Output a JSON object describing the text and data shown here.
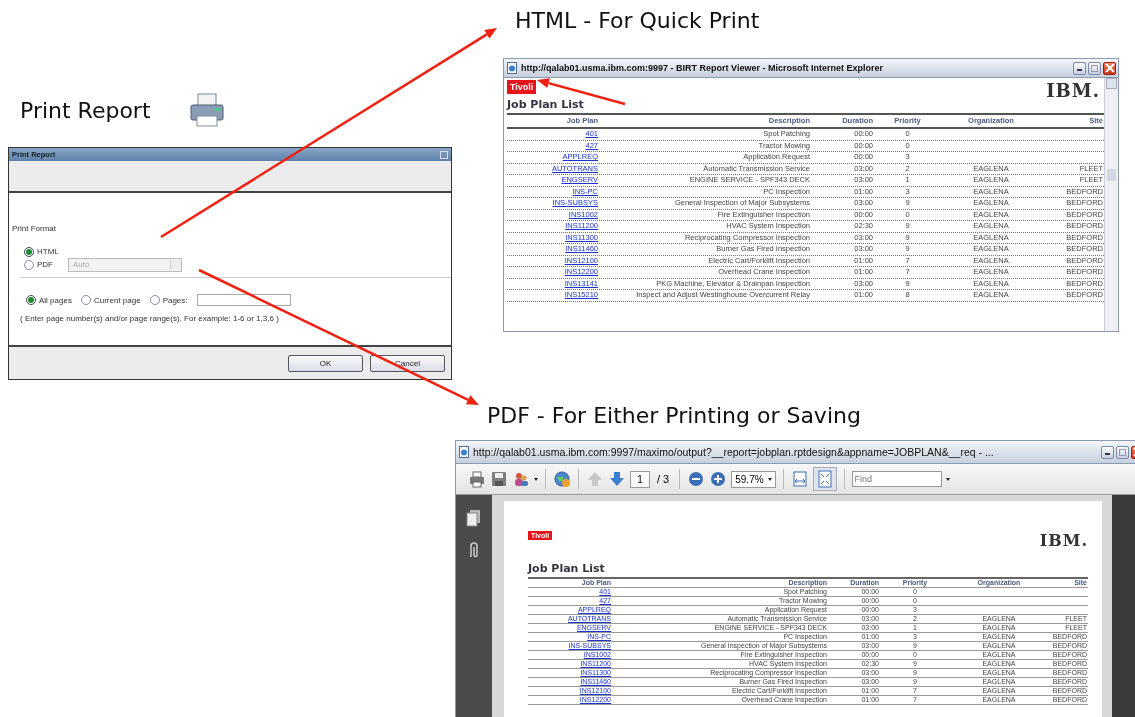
{
  "slide": {
    "print_heading": "Print Report",
    "html_heading": "HTML - For Quick Print",
    "pdf_heading": "PDF - For Either Printing or Saving"
  },
  "print_dialog": {
    "title": "Print Report",
    "format_label": "Print Format",
    "formats": [
      {
        "label": "HTML",
        "selected": true
      },
      {
        "label": "PDF",
        "selected": false
      }
    ],
    "pdf_option": {
      "value": "Auto",
      "disabled": true
    },
    "page_ranges": [
      {
        "label": "All pages",
        "selected": true
      },
      {
        "label": "Current page",
        "selected": false
      },
      {
        "label": "Pages:",
        "selected": false
      }
    ],
    "hint": "( Enter page number(s) and/or page range(s). For example: 1-6 or 1,3,6 )",
    "buttons": [
      "OK",
      "Cancel"
    ]
  },
  "html_window": {
    "title": "http://qalab01.usma.ibm.com:9997 - BIRT Report Viewer - Microsoft Internet Explorer",
    "brand": "Tivoli",
    "logo": "IBM.",
    "report_title": "Job Plan List",
    "columns": [
      "Job Plan",
      "Description",
      "Duration",
      "Priority",
      "Organization",
      "Site"
    ],
    "rows": [
      [
        "401",
        "Spot Patching",
        "00:00",
        "0",
        null,
        null
      ],
      [
        "427",
        "Tractor Mowing",
        "00:00",
        "0",
        null,
        null
      ],
      [
        "APPLREQ",
        "Application Request",
        "00:00",
        "3",
        null,
        null
      ],
      [
        "AUTOTRANS",
        "Automatic Transmission Service",
        "03:00",
        "2",
        "EAGLENA",
        "FLEET"
      ],
      [
        "ENGSERV",
        "ENGINE SERVICE - SPF343 DECK",
        "03:00",
        "1",
        "EAGLENA",
        "FLEET"
      ],
      [
        "INS-PC",
        "PC Inspection",
        "01:00",
        "3",
        "EAGLENA",
        "BEDFORD"
      ],
      [
        "INS-SUBSYS",
        "General Inspection of Major Subsystems",
        "03:00",
        "9",
        "EAGLENA",
        "BEDFORD"
      ],
      [
        "INS1002",
        "Fire Extinguisher Inspection",
        "00:00",
        "0",
        "EAGLENA",
        "BEDFORD"
      ],
      [
        "INS11200",
        "HVAC System Inspection",
        "02:30",
        "9",
        "EAGLENA",
        "BEDFORD"
      ],
      [
        "INS11300",
        "Reciprocating Compressor Inspection",
        "03:00",
        "9",
        "EAGLENA",
        "BEDFORD"
      ],
      [
        "INS11460",
        "Burner Gas Fired Inspection",
        "03:00",
        "9",
        "EAGLENA",
        "BEDFORD"
      ],
      [
        "INS12100",
        "Electric Cart/Forklift Inspection",
        "01:00",
        "7",
        "EAGLENA",
        "BEDFORD"
      ],
      [
        "INS12200",
        "Overhead Crane Inspection",
        "01:00",
        "7",
        "EAGLENA",
        "BEDFORD"
      ],
      [
        "INS13141",
        "PKG Machine, Elevator & Drainpan Inspection",
        "03:00",
        "9",
        "EAGLENA",
        "BEDFORD"
      ],
      [
        "INS15210",
        "Inspect and Adjust Westinghouse Overcurrent Relay",
        "01:00",
        "8",
        "EAGLENA",
        "BEDFORD"
      ]
    ]
  },
  "pdf_window": {
    "title": "http://qalab01.usma.ibm.com:9997/maximo/output?__report=jobplan.rptdesign&appname=JOBPLAN&__req - ...",
    "page": "1",
    "page_count": "/ 3",
    "zoom": "59.7%",
    "find": {
      "placeholder": "Find"
    },
    "brand": "Tivoli",
    "logo": "IBM.",
    "report_title": "Job Plan List",
    "columns": [
      "Job Plan",
      "Description",
      "Duration",
      "Priority",
      "Organization",
      "Site"
    ],
    "rows": [
      [
        "401",
        "Spot Patching",
        "00:00",
        "0",
        null,
        null
      ],
      [
        "427",
        "Tractor Mowing",
        "00:00",
        "0",
        null,
        null
      ],
      [
        "APPLREQ",
        "Application Request",
        "00:00",
        "3",
        null,
        null
      ],
      [
        "AUTOTRANS",
        "Automatic Transmission Service",
        "03:00",
        "2",
        "EAGLENA",
        "FLEET"
      ],
      [
        "ENGSERV",
        "ENGINE SERVICE - SPF343 DECK",
        "03:00",
        "1",
        "EAGLENA",
        "FLEET"
      ],
      [
        "INS-PC",
        "PC Inspection",
        "01:00",
        "3",
        "EAGLENA",
        "BEDFORD"
      ],
      [
        "INS-SUBSYS",
        "General Inspection of Major Subsystems",
        "03:00",
        "9",
        "EAGLENA",
        "BEDFORD"
      ],
      [
        "INS1002",
        "Fire Extinguisher Inspection",
        "00:00",
        "0",
        "EAGLENA",
        "BEDFORD"
      ],
      [
        "INS11200",
        "HVAC System Inspection",
        "02:30",
        "9",
        "EAGLENA",
        "BEDFORD"
      ],
      [
        "INS11300",
        "Reciprocating Compressor Inspection",
        "03:00",
        "9",
        "EAGLENA",
        "BEDFORD"
      ],
      [
        "INS11460",
        "Burner Gas Fired Inspection",
        "03:00",
        "9",
        "EAGLENA",
        "BEDFORD"
      ],
      [
        "INS12100",
        "Electric Cart/Forklift Inspection",
        "01:00",
        "7",
        "EAGLENA",
        "BEDFORD"
      ],
      [
        "INS12200",
        "Overhead Crane Inspection",
        "01:00",
        "7",
        "EAGLENA",
        "BEDFORD"
      ]
    ]
  }
}
